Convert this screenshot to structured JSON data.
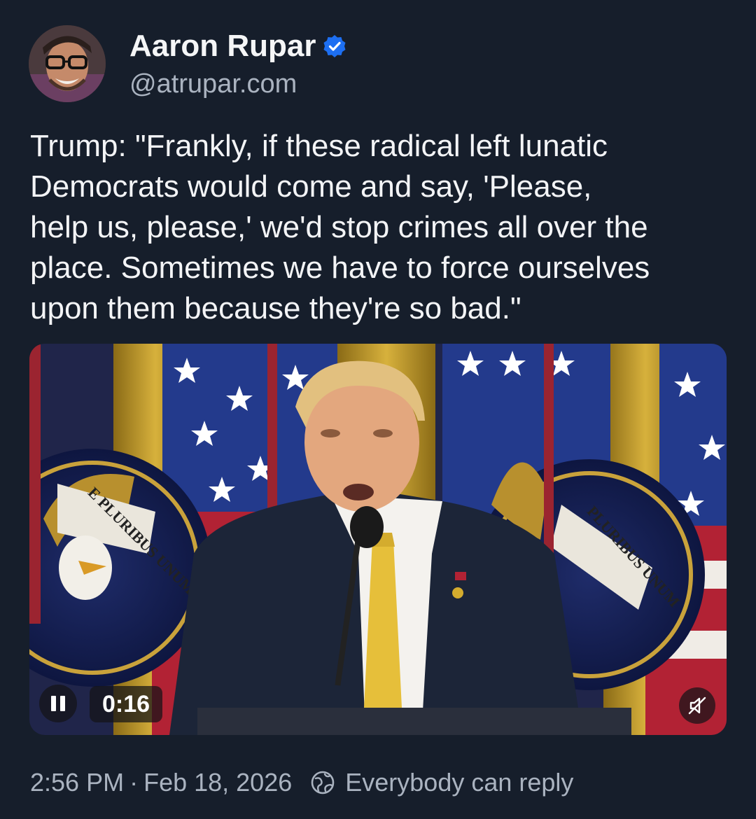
{
  "author": {
    "display_name": "Aaron Rupar",
    "handle": "@atrupar.com",
    "verified": true,
    "avatar_icon": "avatar-photo"
  },
  "post": {
    "text": "Trump: \"Frankly, if these radical left lunatic\nDemocrats would come and say, 'Please,\nhelp us, please,' we'd stop crimes all over the\nplace. Sometimes we have to force ourselves\nupon them because they're so bad.\""
  },
  "video": {
    "elapsed": "0:16",
    "state": "playing",
    "pause_icon": "pause-icon",
    "mute_icon": "speaker-muted-icon",
    "seal_motto_left": "E PLURIBUS UNUM",
    "seal_motto_right": "PLURIBUS UNUM"
  },
  "footer": {
    "time": "2:56 PM",
    "separator": "·",
    "date": "Feb 18, 2026",
    "reply_scope": "Everybody can reply",
    "reply_icon": "globe-icon"
  },
  "colors": {
    "background": "#161e2b",
    "verified_blue": "#1d6ff2",
    "muted_text": "#aab3c0"
  }
}
